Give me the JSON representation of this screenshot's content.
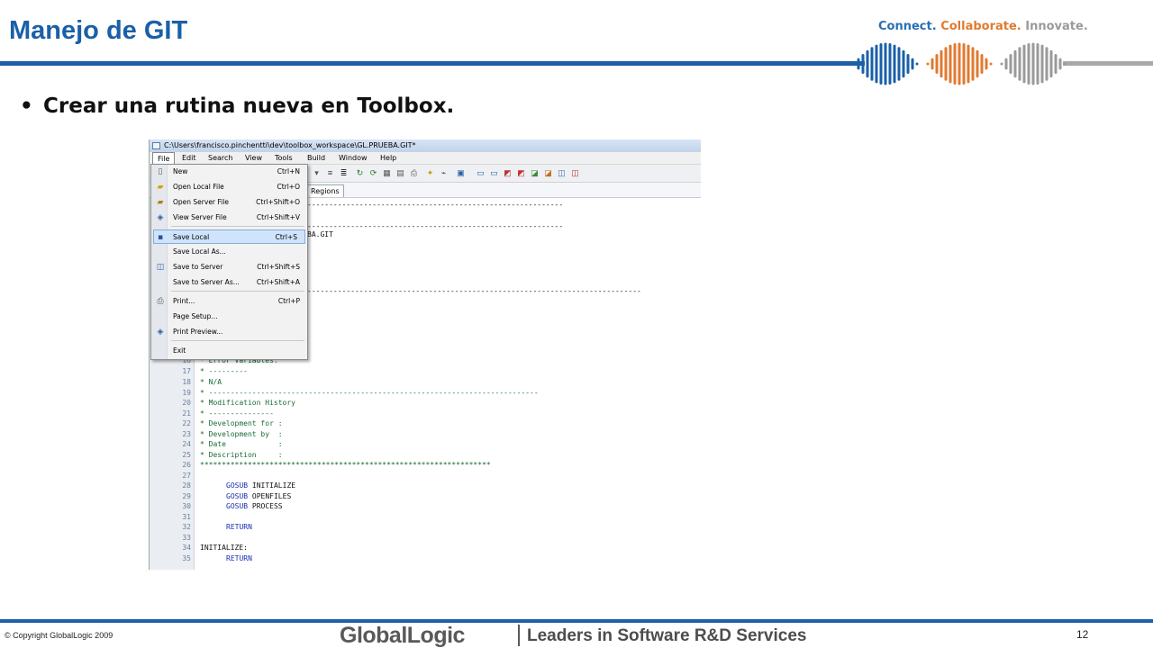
{
  "slide": {
    "title": "Manejo de GIT",
    "tagline": {
      "part1": "Connect.",
      "part2": "Collaborate.",
      "part3": "Innovate."
    },
    "bullet": "Crear una rutina nueva en Toolbox.",
    "bullet_marker": "•",
    "copyright": "© Copyright GlobalLogic 2009",
    "page_number": "12",
    "logo_text": "GlobalLogic",
    "slogan": "Leaders in Software R&D Services",
    "colors": {
      "brand_blue": "#1b5fa8",
      "accent_orange": "#e07a31",
      "gray": "#9a9a9a"
    }
  },
  "screenshot": {
    "window_title": "C:\\Users\\francisco.pinchentti\\dev\\toolbox_workspace\\GL.PRUEBA.GIT*",
    "menubar": [
      "File",
      "Edit",
      "Search",
      "View",
      "Tools",
      "Build",
      "Window",
      "Help"
    ],
    "tab_label": "Regions",
    "file_menu": [
      {
        "label": "New",
        "shortcut": "Ctrl+N",
        "icon": "new-file-icon"
      },
      {
        "label": "Open Local File",
        "shortcut": "Ctrl+O",
        "icon": "open-folder-icon"
      },
      {
        "label": "Open Server File",
        "shortcut": "Ctrl+Shift+O",
        "icon": "open-server-icon"
      },
      {
        "label": "View Server File",
        "shortcut": "Ctrl+Shift+V",
        "icon": "view-server-icon"
      },
      {
        "label": "Save Local",
        "shortcut": "Ctrl+S",
        "icon": "save-icon",
        "highlighted": true
      },
      {
        "label": "Save Local As...",
        "shortcut": "",
        "icon": ""
      },
      {
        "label": "Save to Server",
        "shortcut": "Ctrl+Shift+S",
        "icon": "save-server-icon"
      },
      {
        "label": "Save to Server As...",
        "shortcut": "Ctrl+Shift+A",
        "icon": ""
      },
      {
        "label": "Print...",
        "shortcut": "Ctrl+P",
        "icon": "print-icon"
      },
      {
        "label": "Page Setup...",
        "shortcut": "",
        "icon": ""
      },
      {
        "label": "Print Preview...",
        "shortcut": "",
        "icon": "print-preview-icon"
      },
      {
        "label": "Exit",
        "shortcut": "",
        "icon": ""
      }
    ],
    "code_lines": [
      {
        "text": "-----------------------------------------------------------"
      },
      {
        "text": "-----------------------------------------------------------"
      },
      {
        "text": "BA.GIT"
      },
      {
        "text": "-----------------------------------------------------------------------------"
      },
      {
        "ln": "16",
        "text": "* Error Variables:"
      },
      {
        "ln": "17",
        "text": "* ---------"
      },
      {
        "ln": "18",
        "text": "* N/A"
      },
      {
        "ln": "19",
        "text": "* ----------------------------------------------------------------------------"
      },
      {
        "ln": "20",
        "text": "* Modification History"
      },
      {
        "ln": "21",
        "text": "* ---------------"
      },
      {
        "ln": "22",
        "text": "* Development for :"
      },
      {
        "ln": "23",
        "text": "* Development by  :"
      },
      {
        "ln": "24",
        "text": "* Date            :"
      },
      {
        "ln": "25",
        "text": "* Description     :"
      },
      {
        "ln": "26",
        "text": "*******************************************************************"
      },
      {
        "ln": "27",
        "text": ""
      },
      {
        "ln": "28",
        "kw": "GOSUB",
        "text": " INITIALIZE"
      },
      {
        "ln": "29",
        "kw": "GOSUB",
        "text": " OPENFILES"
      },
      {
        "ln": "30",
        "kw": "GOSUB",
        "text": " PROCESS"
      },
      {
        "ln": "31",
        "text": ""
      },
      {
        "ln": "32",
        "kw": "RETURN",
        "text": ""
      },
      {
        "ln": "33",
        "text": ""
      },
      {
        "ln": "34",
        "text": "INITIALIZE:"
      },
      {
        "ln": "35",
        "kw": "RETURN",
        "text": ""
      }
    ]
  }
}
